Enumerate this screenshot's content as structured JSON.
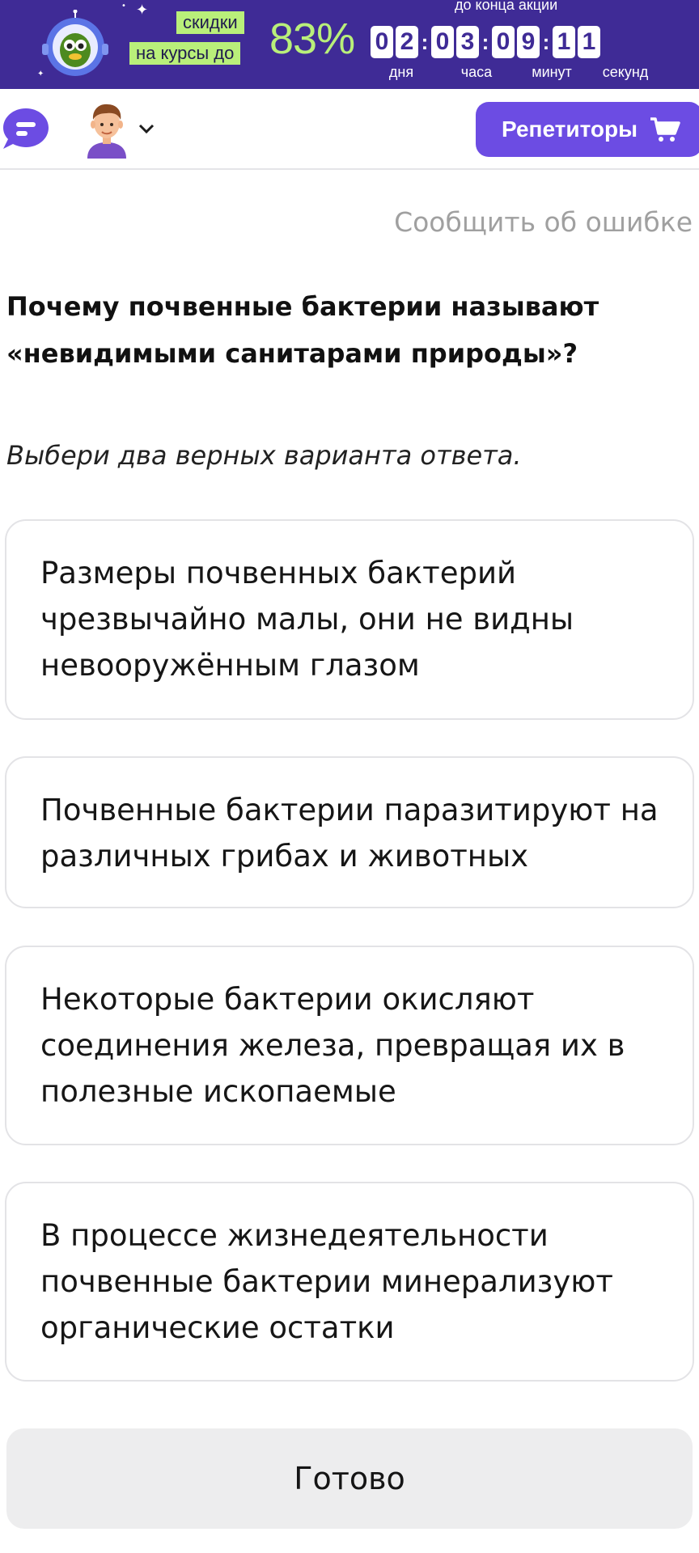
{
  "banner": {
    "tag_line1": "скидки",
    "tag_line2": "на курсы до",
    "discount": "83%",
    "countdown_caption": "до конца акции",
    "digits": {
      "d1": "0",
      "d2": "2",
      "h1": "0",
      "h2": "3",
      "m1": "0",
      "m2": "9",
      "s1": "1",
      "s2": "1"
    },
    "separator": ":",
    "units": {
      "days": "дня",
      "hours": "часа",
      "minutes": "минут",
      "seconds": "секунд"
    },
    "colors": {
      "background": "#3f2b96",
      "accent_green": "#b9ef7a"
    }
  },
  "header": {
    "chat_icon": "chat-bubble-icon",
    "avatar_icon": "user-avatar-icon",
    "tutors_button": "Репетиторы",
    "cart_icon": "cart-icon",
    "colors": {
      "button": "#6c4ce3"
    }
  },
  "task": {
    "report_link": "Сообщить об ошибке",
    "question": "Почему почвенные бактерии называют «невидимыми санитарами природы»?",
    "instruction": "Выбери два верных варианта ответа.",
    "options": [
      "Размеры почвенных бактерий чрезвычайно малы, они не видны невооружённым глазом",
      "Почвенные бактерии паразитируют на различных грибах и животных",
      "Некоторые бактерии окисляют соединения железа, превращая их в полезные ископаемые",
      "В процессе жизнедеятельности почвенные бактерии минерализуют органические остатки"
    ],
    "submit_button": "Готово"
  }
}
